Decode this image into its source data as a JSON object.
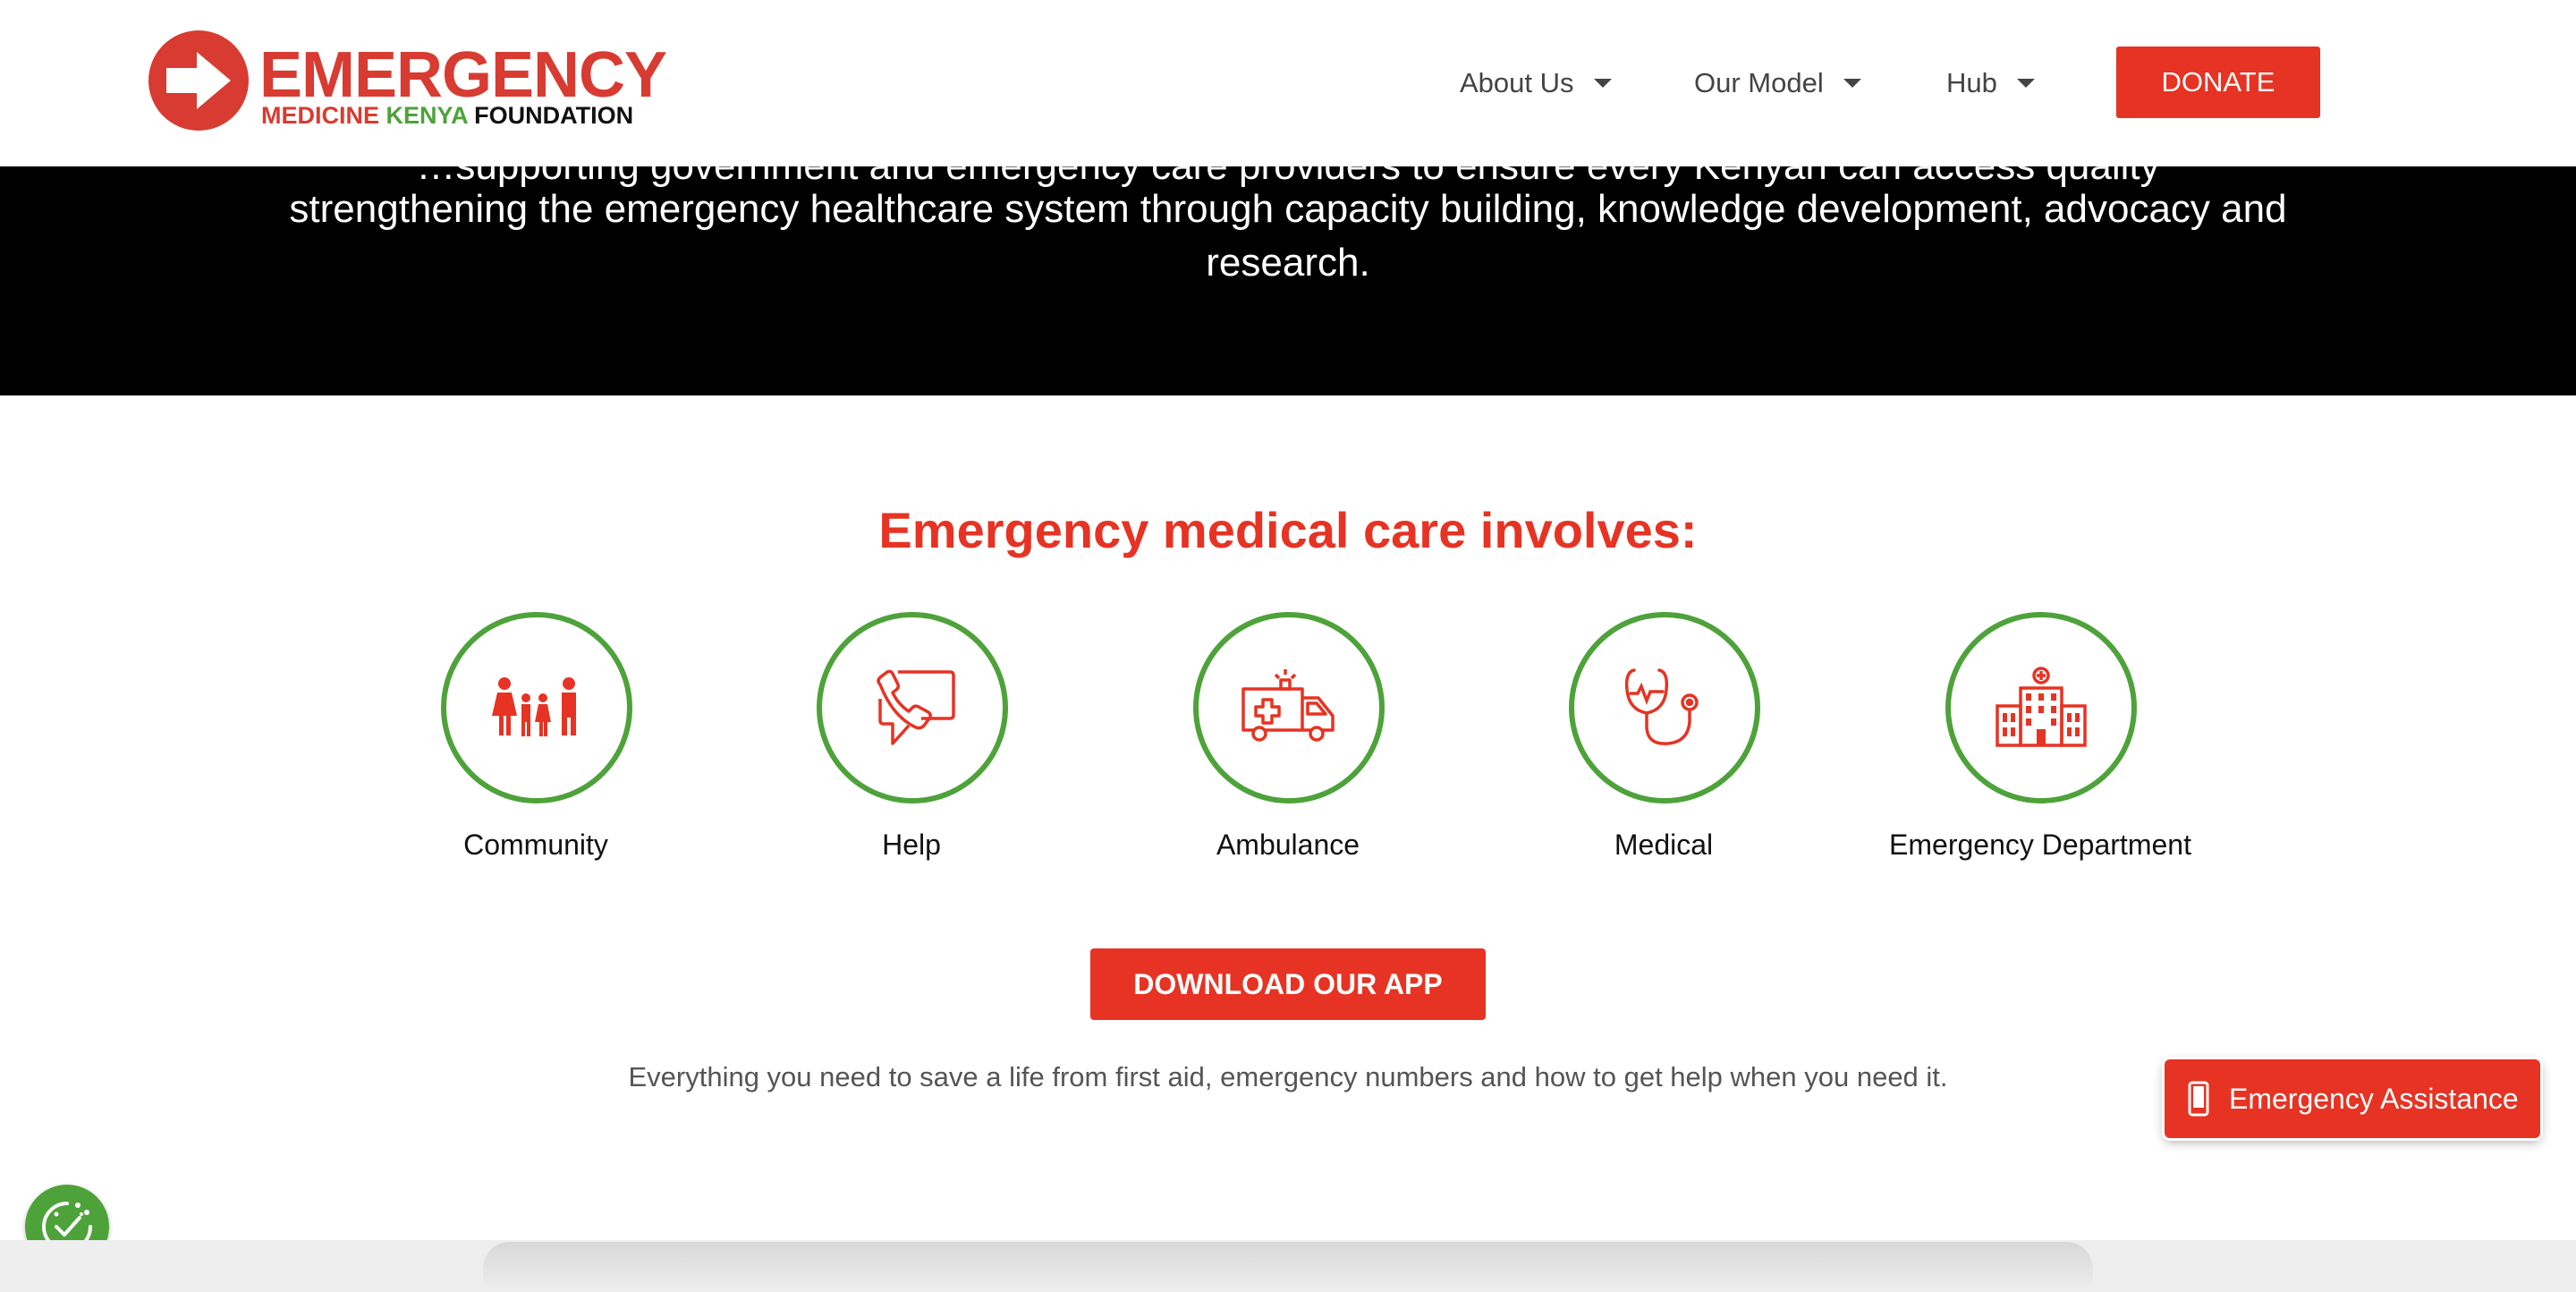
{
  "header": {
    "logo": {
      "word1": "EMERGENCY",
      "word2_medicine": "MEDICINE",
      "word2_kenya": "KENYA",
      "word2_foundation": "FOUNDATION"
    },
    "nav": [
      {
        "label": "About Us"
      },
      {
        "label": "Our Model"
      },
      {
        "label": "Hub"
      }
    ],
    "donate_label": "DONATE"
  },
  "banner": {
    "partial_line": "…supporting government and emergency care providers to ensure every Kenyan can access quality",
    "text": "strengthening the emergency healthcare system through capacity building, knowledge development, advocacy and research."
  },
  "main": {
    "title": "Emergency medical care involves:",
    "features": [
      {
        "label": "Community",
        "icon": "family-icon"
      },
      {
        "label": "Help",
        "icon": "phone-chat-icon"
      },
      {
        "label": "Ambulance",
        "icon": "ambulance-icon"
      },
      {
        "label": "Medical",
        "icon": "stethoscope-icon"
      },
      {
        "label": "Emergency Department",
        "icon": "hospital-icon"
      }
    ],
    "download_label": "DOWNLOAD OUR APP",
    "tagline": "Everything you need to save a life from first aid, emergency numbers and how to get help when you need it."
  },
  "floating": {
    "emergency_assistance_label": "Emergency Assistance"
  },
  "colors": {
    "brand_red": "#e63323",
    "brand_green": "#4ea23a"
  }
}
